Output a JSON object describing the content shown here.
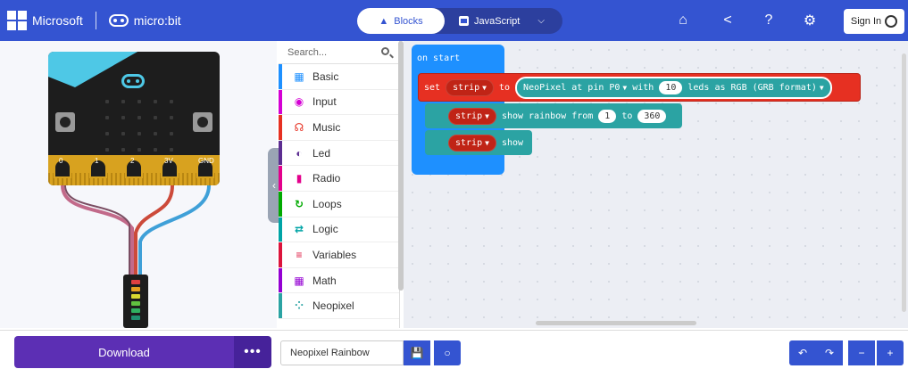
{
  "header": {
    "brand_microsoft": "Microsoft",
    "brand_microbit": "micro:bit",
    "tabs": [
      {
        "label": "Blocks",
        "active": true
      },
      {
        "label": "JavaScript",
        "active": false
      }
    ],
    "sign_in": "Sign In"
  },
  "toolbox": {
    "search_placeholder": "Search...",
    "categories": [
      {
        "label": "Basic",
        "color": "#1E90FF",
        "icon": "grid-icon"
      },
      {
        "label": "Input",
        "color": "#D400D4",
        "icon": "target-icon"
      },
      {
        "label": "Music",
        "color": "#E63022",
        "icon": "headphones-icon"
      },
      {
        "label": "Led",
        "color": "#5C2D91",
        "icon": "toggle-icon"
      },
      {
        "label": "Radio",
        "color": "#E3008C",
        "icon": "signal-icon"
      },
      {
        "label": "Loops",
        "color": "#00AA00",
        "icon": "loop-icon"
      },
      {
        "label": "Logic",
        "color": "#00A4A6",
        "icon": "shuffle-icon"
      },
      {
        "label": "Variables",
        "color": "#DC143C",
        "icon": "lines-icon"
      },
      {
        "label": "Math",
        "color": "#9400D3",
        "icon": "calculator-icon"
      },
      {
        "label": "Neopixel",
        "color": "#2BA3A3",
        "icon": "dots-circle-icon"
      }
    ]
  },
  "workspace": {
    "on_start_label": "on start",
    "set_block": {
      "set": "set",
      "var": "strip",
      "to": "to",
      "neopixel_text": "NeoPixel at pin",
      "pin": "P0",
      "with": "with",
      "count": "10",
      "leds_as": "leds as",
      "mode": "RGB (GRB format)"
    },
    "rainbow_block": {
      "var": "strip",
      "text": "show rainbow from",
      "from": "1",
      "to_label": "to",
      "to": "360"
    },
    "show_block": {
      "var": "strip",
      "text": "show"
    }
  },
  "simulator": {
    "pins": [
      "0",
      "1",
      "2",
      "3V",
      "GND"
    ]
  },
  "bottom": {
    "download": "Download",
    "more": "•••",
    "project_name": "Neopixel Rainbow"
  },
  "colors": {
    "header": "#3454D1",
    "download": "#5c2fb4",
    "on_start": "#1E90FF",
    "variable": "#E63022",
    "neopixel": "#2BA3A3"
  }
}
